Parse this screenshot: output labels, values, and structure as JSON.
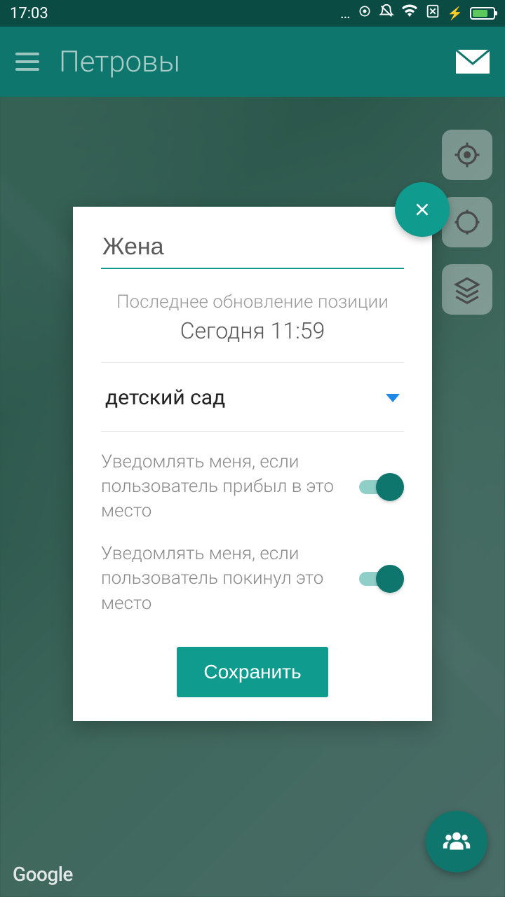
{
  "status_bar": {
    "time": "17:03"
  },
  "header": {
    "title": "Петровы"
  },
  "dialog": {
    "name_value": "Жена",
    "last_update_label": "Последнее обновление позиции",
    "last_update_time": "Сегодня 11:59",
    "dropdown_selected": "детский сад",
    "toggles": [
      {
        "label": "Уведомлять меня, если пользователь прибыл в это место",
        "on": true
      },
      {
        "label": "Уведомлять меня, если пользователь покинул это место",
        "on": true
      }
    ],
    "save_label": "Сохранить"
  },
  "map": {
    "attribution": "Google"
  },
  "colors": {
    "accent": "#0f766e",
    "accent_light": "#0f9b8e"
  }
}
